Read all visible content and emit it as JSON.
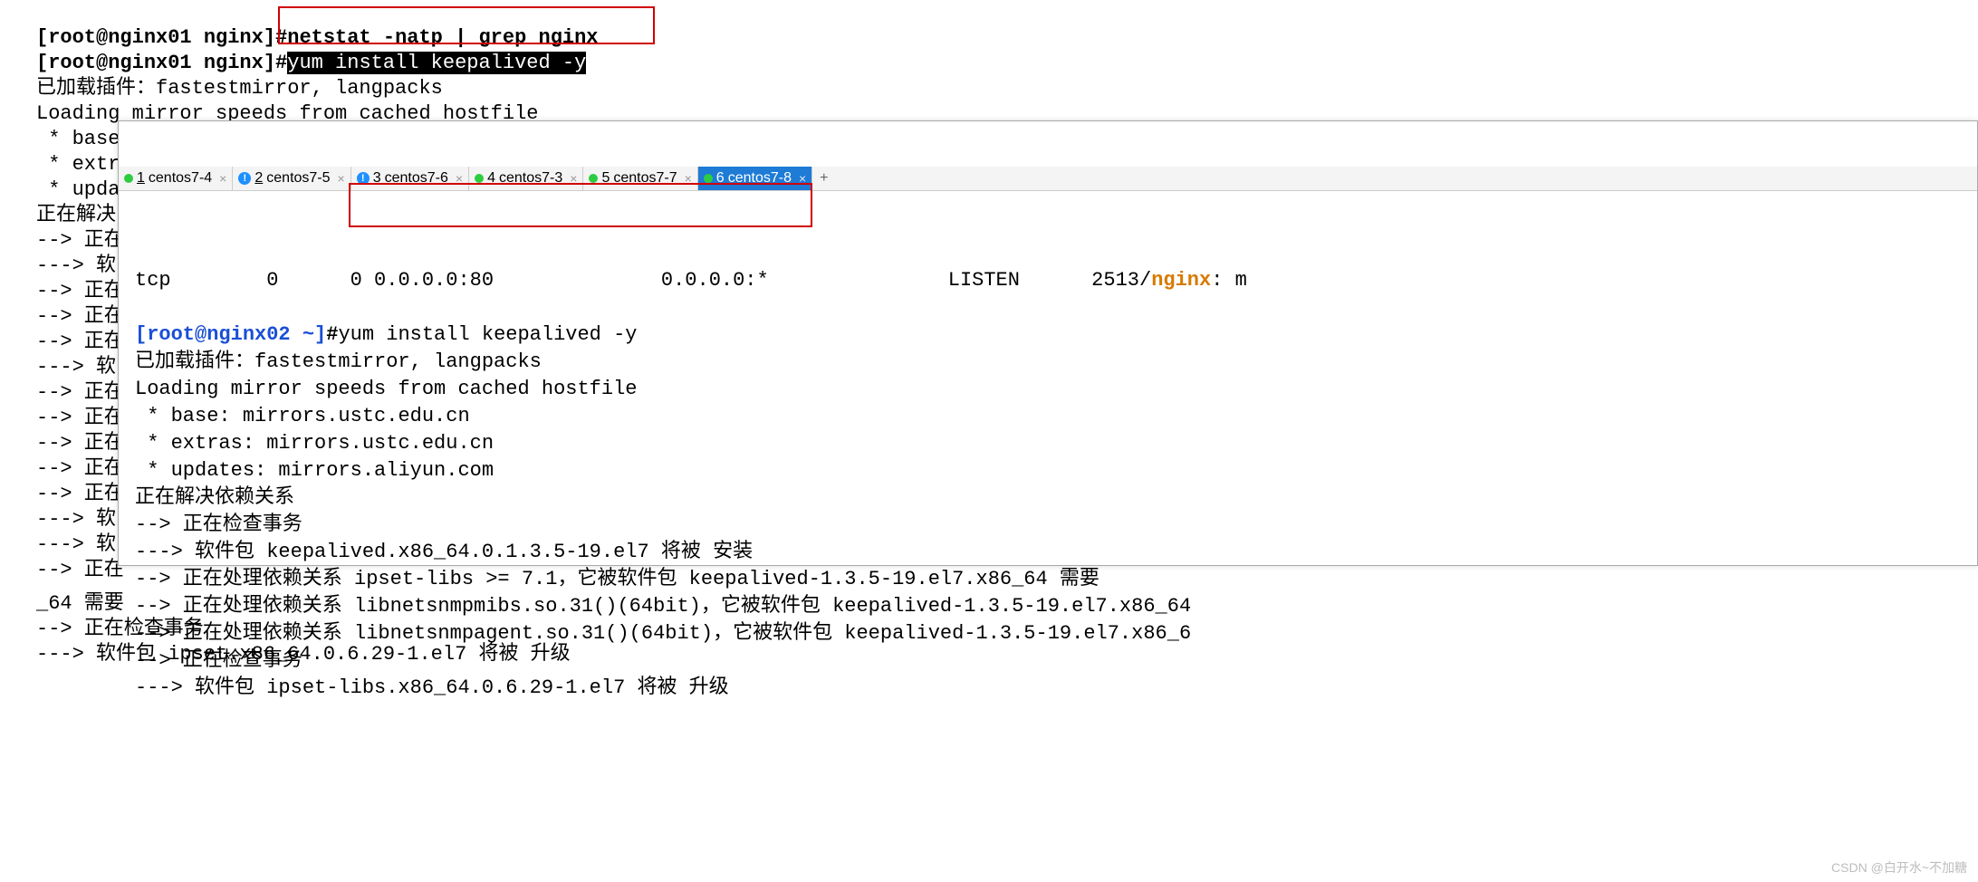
{
  "back": {
    "line0_prefix": "[root@nginx01 nginx]",
    "line0_prev": "#netstat -natp | grep nginx",
    "line1_prefix": "[root@nginx01 nginx]",
    "line1_hash": "#",
    "line1_cmd": "yum install keepalived -y",
    "l2": "已加载插件：fastestmirror, langpacks",
    "l3": "Loading mirror speeds from cached hostfile",
    "l4": " * base: ftp.sjtu.edu.cn",
    "l5": " * extras: mirrors.ustc.edu.cn",
    "l6": " * updat",
    "l7": "正在解决",
    "frag1": "--> 正在",
    "frag2": "---> 软",
    "frag3": "---> 软",
    "frag4": "--> 正在"
  },
  "tabs": [
    {
      "num": "1",
      "name": "centos7-4",
      "icon": "green"
    },
    {
      "num": "2",
      "name": "centos7-5",
      "icon": "blue"
    },
    {
      "num": "3",
      "name": "centos7-6",
      "icon": "blue"
    },
    {
      "num": "4",
      "name": "centos7-3",
      "icon": "green"
    },
    {
      "num": "5",
      "name": "centos7-7",
      "icon": "green"
    },
    {
      "num": "6",
      "name": "centos7-8",
      "icon": "green",
      "active": true
    }
  ],
  "front": {
    "netstat_line_pre": "tcp        0      0 0.0.0.0:80              0.0.0.0:*               LISTEN      2513/",
    "netstat_proc": "nginx",
    "netstat_tail": ": m",
    "prompt_user": "[root@nginx02 ~]",
    "prompt_hash": "#",
    "prompt_cmd": "yum install keepalived -y",
    "l1": "已加载插件：fastestmirror, langpacks",
    "l2": "Loading mirror speeds from cached hostfile",
    "l3": " * base: mirrors.ustc.edu.cn",
    "l4": " * extras: mirrors.ustc.edu.cn",
    "l5": " * updates: mirrors.aliyun.com",
    "l6": "正在解决依赖关系",
    "l7": "--> 正在检查事务",
    "l8": "---> 软件包 keepalived.x86_64.0.1.3.5-19.el7 将被 安装",
    "l9": "--> 正在处理依赖关系 ipset-libs >= 7.1，它被软件包 keepalived-1.3.5-19.el7.x86_64 需要",
    "l10": "--> 正在处理依赖关系 libnetsnmpmibs.so.31()(64bit)，它被软件包 keepalived-1.3.5-19.el7.x86_64",
    "l11": "--> 正在处理依赖关系 libnetsnmpagent.so.31()(64bit)，它被软件包 keepalived-1.3.5-19.el7.x86_6",
    "l12": "--> 正在检查事务",
    "l13": "---> 软件包 ipset-libs.x86_64.0.6.29-1.el7 将被 升级"
  },
  "backBottom": {
    "b1": "_64 需要",
    "b2": "--> 正在检查事务",
    "b3": "---> 软件包 ipset.x86_64.0.6.29-1.el7 将被 升级"
  },
  "watermark": "CSDN @白开水~不加糖"
}
